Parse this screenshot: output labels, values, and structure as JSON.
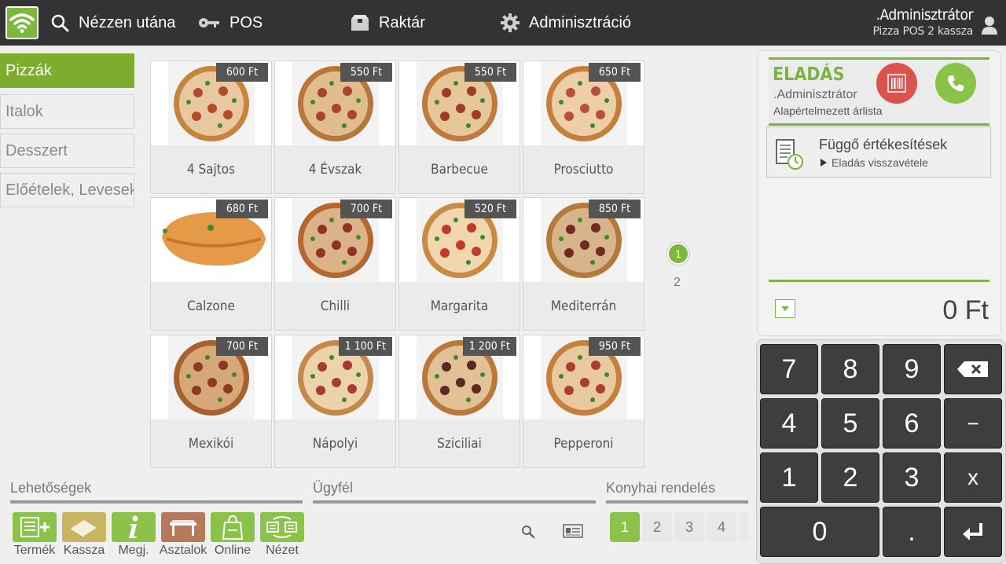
{
  "nav": {
    "search": "Nézzen utána",
    "pos": "POS",
    "warehouse": "Raktár",
    "admin": "Adminisztráció"
  },
  "user": {
    "name": ".Adminisztrátor",
    "register": "Pizza POS 2 kassza"
  },
  "categories": [
    "Pizzák",
    "Italok",
    "Desszert",
    "Előételek, Levesek"
  ],
  "products": [
    {
      "name": "4 Sajtos",
      "price": "600 Ft"
    },
    {
      "name": "4 Évszak",
      "price": "550 Ft"
    },
    {
      "name": "Barbecue",
      "price": "550 Ft"
    },
    {
      "name": "Prosciutto",
      "price": "650 Ft"
    },
    {
      "name": "Calzone",
      "price": "680 Ft"
    },
    {
      "name": "Chilli",
      "price": "700 Ft"
    },
    {
      "name": "Margarita",
      "price": "520 Ft"
    },
    {
      "name": "Mediterrán",
      "price": "850 Ft"
    },
    {
      "name": "Mexikói",
      "price": "700 Ft"
    },
    {
      "name": "Nápolyi",
      "price": "1 100 Ft"
    },
    {
      "name": "Sziciliai",
      "price": "1 200 Ft"
    },
    {
      "name": "Pepperoni",
      "price": "950 Ft"
    }
  ],
  "pager": {
    "current": "1",
    "next": "2"
  },
  "options": {
    "title": "Lehetőségek",
    "tools": [
      "Termék",
      "Kassza",
      "Megj.",
      "Asztalok",
      "Online",
      "Nézet"
    ]
  },
  "customer": {
    "title": "Ügyfél"
  },
  "kitchen": {
    "title": "Konyhai rendelés",
    "chips": [
      "1",
      "2",
      "3",
      "4"
    ]
  },
  "sale": {
    "title": "ELADÁS",
    "user": ".Adminisztrátor",
    "pricelist": "Alapértelmezett árlista",
    "pending_title": "Függő értékesítések",
    "pending_sub": "Eladás visszavétele",
    "total": "0 Ft"
  },
  "numpad": {
    "k7": "7",
    "k8": "8",
    "k9": "9",
    "k4": "4",
    "k5": "5",
    "k6": "6",
    "minus": "−",
    "k1": "1",
    "k2": "2",
    "k3": "3",
    "times": "x",
    "k0": "0",
    "dot": "."
  },
  "colors": {
    "accent": "#7cb83c",
    "topbar": "#333333",
    "price_badge": "#545454",
    "barcode_button": "#d9534f"
  },
  "icons": {
    "wifi": "wifi-icon",
    "search": "search-icon",
    "key": "key-icon",
    "box": "box-icon",
    "gear": "gear-icon",
    "user": "user-icon",
    "barcode": "barcode-icon",
    "phone": "phone-icon",
    "backspace": "backspace-icon",
    "enter": "enter-icon"
  }
}
